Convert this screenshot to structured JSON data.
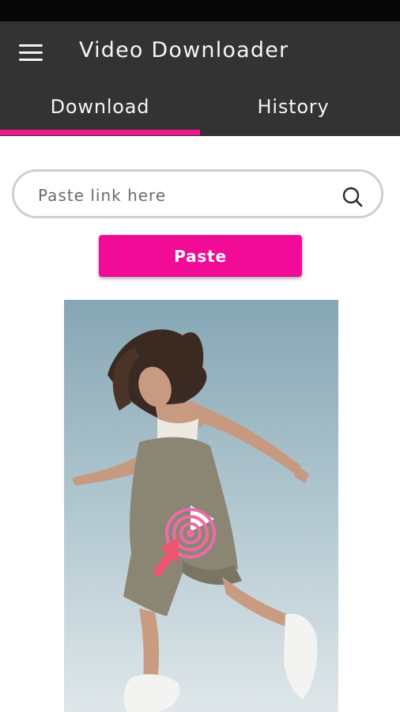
{
  "app": {
    "title": "Video Downloader"
  },
  "tabs": [
    {
      "label": "Download",
      "active": true
    },
    {
      "label": "History",
      "active": false
    }
  ],
  "search": {
    "placeholder": "Paste link here",
    "value": ""
  },
  "paste_button": {
    "label": "Paste"
  },
  "colors": {
    "accent": "#f0168f",
    "app_bar": "#333333",
    "status_bar": "#060606"
  },
  "icons": {
    "menu": "hamburger-menu-icon",
    "search": "search-icon",
    "hero_overlay": "tap-play-icon"
  }
}
